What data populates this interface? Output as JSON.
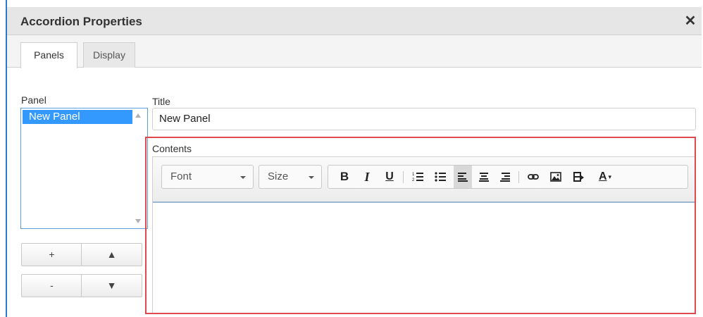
{
  "dialog": {
    "title": "Accordion Properties",
    "close_glyph": "✕"
  },
  "tabs": [
    {
      "label": "Panels",
      "active": true
    },
    {
      "label": "Display",
      "active": false
    }
  ],
  "panel_section": {
    "label": "Panel",
    "items": [
      "New Panel"
    ],
    "selected": "New Panel",
    "buttons": {
      "add": "+",
      "move_up": "▲",
      "remove": "-",
      "move_down": "▼"
    }
  },
  "title_field": {
    "label": "Title",
    "value": "New Panel"
  },
  "contents": {
    "label": "Contents",
    "toolbar": {
      "font_label": "Font",
      "size_label": "Size",
      "bold": "B",
      "italic": "I",
      "underline": "U",
      "text_color": "A",
      "buttons": [
        "bold-icon",
        "italic-icon",
        "underline-icon",
        "ordered-list-icon",
        "unordered-list-icon",
        "align-left-icon",
        "align-center-icon",
        "align-right-icon",
        "link-icon",
        "image-icon",
        "video-icon",
        "text-color-icon"
      ],
      "active_button": "align-left-icon"
    }
  },
  "colors": {
    "highlight_outline": "#e04850",
    "selection": "#3399ff",
    "window_border": "#2a7ad0"
  }
}
